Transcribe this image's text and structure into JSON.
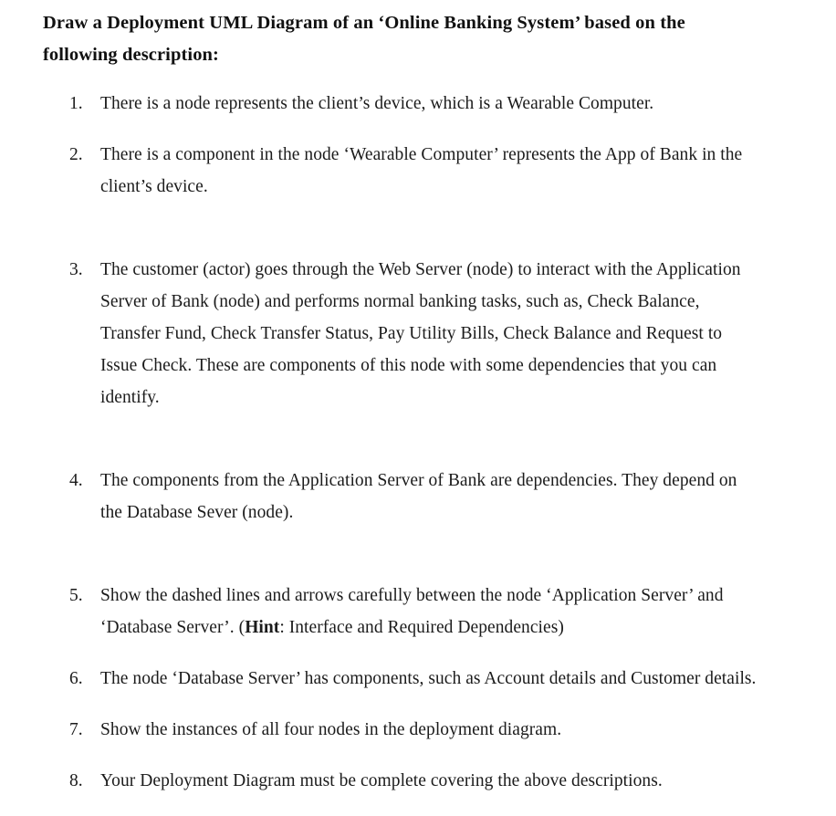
{
  "document": {
    "heading": "Draw a Deployment UML Diagram of an ‘Online Banking System’ based on the following description:",
    "items": [
      {
        "marker": "1.",
        "text": "There is a node represents the client’s device, which is a Wearable Computer.",
        "justified": false
      },
      {
        "marker": "2.",
        "text": "There is a component in the node ‘Wearable Computer’ represents the App of Bank in the client’s device.",
        "justified": true
      },
      {
        "marker": "3.",
        "text": "The customer (actor) goes through the Web Server (node) to interact with the Application Server of Bank (node) and performs normal banking tasks, such as, Check Balance, Transfer Fund, Check Transfer Status, Pay Utility Bills, Check Balance and Request to Issue Check. These are components of this node with some dependencies that you can identify.",
        "justified": true
      },
      {
        "marker": "4.",
        "text": "The components from the Application Server of Bank are dependencies. They depend on the Database Sever (node).",
        "justified": true
      },
      {
        "marker": "5.",
        "text_before_bold": "Show the dashed lines and arrows carefully between the node ‘Application Server’ and ‘Database Server’. (",
        "bold_word": "Hint",
        "text_after_bold": ": Interface and Required Dependencies)",
        "justified": false
      },
      {
        "marker": "6.",
        "text": "The node ‘Database Server’ has components, such as Account details and Customer details.",
        "justified": false
      },
      {
        "marker": "7.",
        "text": "Show the instances of all four nodes in the deployment diagram.",
        "justified": false
      },
      {
        "marker": "8.",
        "text": "Your Deployment Diagram must be complete covering the above descriptions.",
        "justified": false
      }
    ]
  }
}
